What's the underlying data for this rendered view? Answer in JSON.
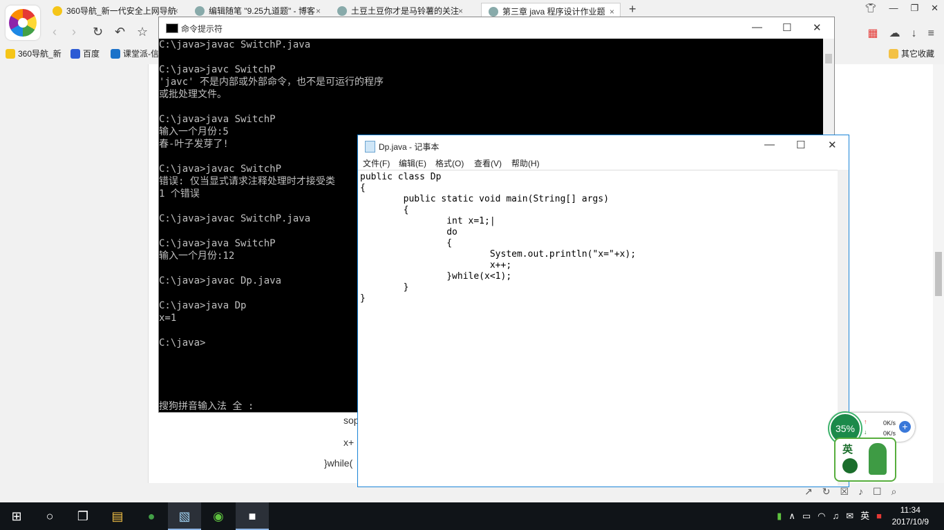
{
  "browser": {
    "tabs": [
      {
        "label": "360导航_新一代安全上网导航",
        "close": "×"
      },
      {
        "label": "编辑随笔 \"9.25九道题\" - 博客",
        "close": "×"
      },
      {
        "label": "土豆土豆你才是马铃薯的关注",
        "close": "×"
      },
      {
        "label": "第三章 java 程序设计作业题",
        "close": "×"
      }
    ],
    "new_tab": "+",
    "bookmarks": [
      {
        "label": "360导航_新"
      },
      {
        "label": "百度"
      },
      {
        "label": "课堂派-信"
      }
    ],
    "other_bookmarks": "其它收藏"
  },
  "page": {
    "lines": [
      "sop",
      "x+",
      "}while("
    ]
  },
  "cmd": {
    "title": "命令提示符",
    "lines": [
      "C:\\java>javac SwitchP.java",
      "",
      "C:\\java>javc SwitchP",
      "'javc' 不是内部或外部命令，也不是可运行的程序",
      "或批处理文件。",
      "",
      "C:\\java>java SwitchP",
      "输入一个月份:5",
      "春-叶子发芽了!",
      "",
      "C:\\java>javac SwitchP",
      "错误: 仅当显式请求注释处理时才接受类",
      "1 个错误",
      "",
      "C:\\java>javac SwitchP.java",
      "",
      "C:\\java>java SwitchP",
      "输入一个月份:12",
      "",
      "C:\\java>javac Dp.java",
      "",
      "C:\\java>java Dp",
      "x=1",
      "",
      "C:\\java>"
    ],
    "ime_status": "搜狗拼音输入法 全 :"
  },
  "notepad": {
    "title": "Dp.java - 记事本",
    "menu": [
      "文件(F)",
      "编辑(E)",
      "格式(O)",
      "查看(V)",
      "帮助(H)"
    ],
    "code": "public class Dp\n{\n        public static void main(String[] args)\n        {\n                int x=1;|\n                do\n                {\n                        System.out.println(\"x=\"+x);\n                        x++;\n                }while(x<1);\n        }\n}"
  },
  "netmon": {
    "percent": "35%",
    "up": "0K/s",
    "down": "0K/s"
  },
  "ime_widget": {
    "char": "英"
  },
  "taskbar": {
    "tray_ime": "英",
    "time": "11:34",
    "date": "2017/10/9"
  }
}
